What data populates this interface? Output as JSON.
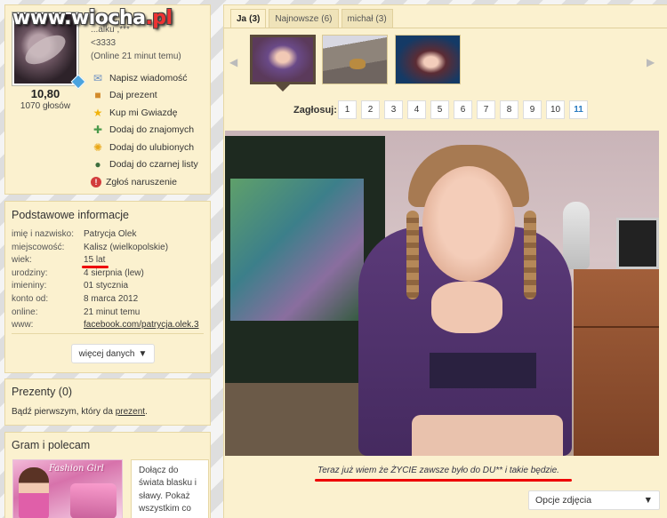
{
  "watermark": {
    "brand": "www.wiocha",
    "tld": ".pl"
  },
  "profile": {
    "line1": "...alku ,***",
    "line2": "<3333",
    "online": "(Online 21 minut temu)",
    "score": "10,80",
    "votes": "1070 głosów",
    "actions": [
      {
        "icon": "mail-icon",
        "label": "Napisz wiadomość"
      },
      {
        "icon": "gift-icon",
        "label": "Daj prezent"
      },
      {
        "icon": "star-icon",
        "label": "Kup mi Gwiazdę"
      },
      {
        "icon": "add-friend-icon",
        "label": "Dodaj do znajomych"
      },
      {
        "icon": "favorite-icon",
        "label": "Dodaj do ulubionych"
      },
      {
        "icon": "blacklist-icon",
        "label": "Dodaj do czarnej listy"
      },
      {
        "icon": "report-icon",
        "label": "Zgłoś naruszenie"
      }
    ]
  },
  "info": {
    "title": "Podstawowe informacje",
    "rows": [
      {
        "label": "imię i nazwisko:",
        "value": "Patrycja Olek"
      },
      {
        "label": "miejscowość:",
        "value": "Kalisz (wielkopolskie)"
      },
      {
        "label": "wiek:",
        "value": "15 lat"
      },
      {
        "label": "urodziny:",
        "value": "4 sierpnia (lew)"
      },
      {
        "label": "imieniny:",
        "value": "01 stycznia"
      },
      {
        "label": "konto od:",
        "value": "8 marca 2012"
      },
      {
        "label": "online:",
        "value": "21 minut temu"
      },
      {
        "label": "www:",
        "value": "facebook.com/patrycja.olek.3"
      }
    ],
    "more_button": "więcej danych",
    "more_icon": "▼"
  },
  "gifts": {
    "title": "Prezenty (0)",
    "text_before": "Bądź pierwszym, który da ",
    "link": "prezent",
    "text_after": "."
  },
  "play": {
    "title": "Gram i polecam",
    "game_logo": "Fashion Girl",
    "description": "Dołącz do świata blasku i sławy. Pokaż wszystkim co"
  },
  "gallery": {
    "tabs": [
      {
        "label": "Ja",
        "count": "(3)"
      },
      {
        "label": "Najnowsze",
        "count": "(6)"
      },
      {
        "label": "michał",
        "count": "(3)"
      }
    ],
    "vote_label": "Zagłosuj:",
    "vote_options": [
      "1",
      "2",
      "3",
      "4",
      "5",
      "6",
      "7",
      "8",
      "9",
      "10",
      "11"
    ],
    "caption": "Teraz już wiem że ŻYCIE zawsze było do DU** i takie będzie.",
    "options_button": "Opcje zdjęcia",
    "options_icon": "▼",
    "prev_arrow": "◀",
    "next_arrow": "▶"
  },
  "colors": {
    "panel": "#fbf1cf",
    "highlight": "#e00000",
    "link": "#2a7bc0"
  }
}
